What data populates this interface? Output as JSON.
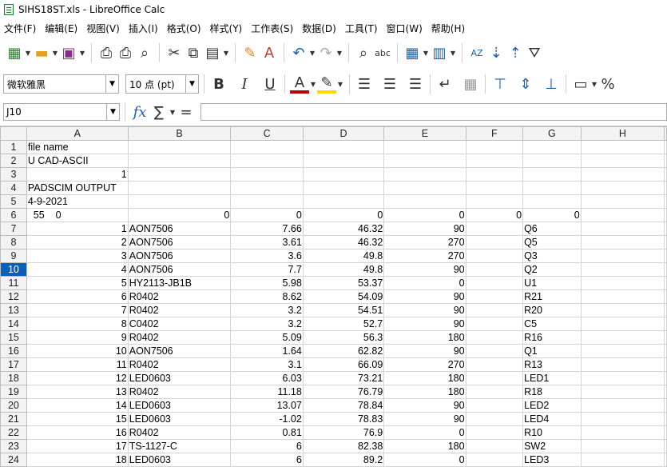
{
  "window": {
    "title": "SIHS18ST.xls - LibreOffice Calc"
  },
  "menu": [
    "文件(F)",
    "编辑(E)",
    "视图(V)",
    "插入(I)",
    "格式(O)",
    "样式(Y)",
    "工作表(S)",
    "数据(D)",
    "工具(T)",
    "窗口(W)",
    "帮助(H)"
  ],
  "format": {
    "font_name": "微软雅黑",
    "font_size": "10 点 (pt)"
  },
  "formula": {
    "cell_ref": "J10",
    "content": ""
  },
  "sheet": {
    "selected_row": 10,
    "columns": [
      "A",
      "B",
      "C",
      "D",
      "E",
      "F",
      "G",
      "H"
    ],
    "rows": [
      {
        "n": 1,
        "cells": [
          "file name",
          "",
          "",
          "",
          "",
          "",
          "",
          ""
        ]
      },
      {
        "n": 2,
        "cells": [
          "U CAD-ASCII",
          "",
          "",
          "",
          "",
          "",
          "",
          ""
        ]
      },
      {
        "n": 3,
        "cells": [
          "1",
          "",
          "",
          "",
          "",
          "",
          "",
          ""
        ]
      },
      {
        "n": 4,
        "cells": [
          "PADSCIM OUTPUT",
          "",
          "",
          "",
          "",
          "",
          "",
          ""
        ]
      },
      {
        "n": 5,
        "cells": [
          "4-9-2021",
          "",
          "",
          "",
          "",
          "",
          "",
          ""
        ]
      },
      {
        "n": 6,
        "cells": [
          "  55    0",
          "0",
          "0",
          "0",
          "0",
          "0",
          "0",
          ""
        ]
      },
      {
        "n": 7,
        "cells": [
          "1",
          "AON7506",
          "7.66",
          "46.32",
          "90",
          "",
          "Q6",
          ""
        ]
      },
      {
        "n": 8,
        "cells": [
          "2",
          "AON7506",
          "3.61",
          "46.32",
          "270",
          "",
          "Q5",
          ""
        ]
      },
      {
        "n": 9,
        "cells": [
          "3",
          "AON7506",
          "3.6",
          "49.8",
          "270",
          "",
          "Q3",
          ""
        ]
      },
      {
        "n": 10,
        "cells": [
          "4",
          "AON7506",
          "7.7",
          "49.8",
          "90",
          "",
          "Q2",
          ""
        ]
      },
      {
        "n": 11,
        "cells": [
          "5",
          "HY2113-JB1B",
          "5.98",
          "53.37",
          "0",
          "",
          "U1",
          ""
        ]
      },
      {
        "n": 12,
        "cells": [
          "6",
          "R0402",
          "8.62",
          "54.09",
          "90",
          "",
          "R21",
          ""
        ]
      },
      {
        "n": 13,
        "cells": [
          "7",
          "R0402",
          "3.2",
          "54.51",
          "90",
          "",
          "R20",
          ""
        ]
      },
      {
        "n": 14,
        "cells": [
          "8",
          "C0402",
          "3.2",
          "52.7",
          "90",
          "",
          "C5",
          ""
        ]
      },
      {
        "n": 15,
        "cells": [
          "9",
          "R0402",
          "5.09",
          "56.3",
          "180",
          "",
          "R16",
          ""
        ]
      },
      {
        "n": 16,
        "cells": [
          "10",
          "AON7506",
          "1.64",
          "62.82",
          "90",
          "",
          "Q1",
          ""
        ]
      },
      {
        "n": 17,
        "cells": [
          "11",
          "R0402",
          "3.1",
          "66.09",
          "270",
          "",
          "R13",
          ""
        ]
      },
      {
        "n": 18,
        "cells": [
          "12",
          "LED0603",
          "6.03",
          "73.21",
          "180",
          "",
          "LED1",
          ""
        ]
      },
      {
        "n": 19,
        "cells": [
          "13",
          "R0402",
          "11.18",
          "76.79",
          "180",
          "",
          "R18",
          ""
        ]
      },
      {
        "n": 20,
        "cells": [
          "14",
          "LED0603",
          "13.07",
          "78.84",
          "90",
          "",
          "LED2",
          ""
        ]
      },
      {
        "n": 21,
        "cells": [
          "15",
          "LED0603",
          "-1.02",
          "78.83",
          "90",
          "",
          "LED4",
          ""
        ]
      },
      {
        "n": 22,
        "cells": [
          "16",
          "R0402",
          "0.81",
          "76.9",
          "0",
          "",
          "R10",
          ""
        ]
      },
      {
        "n": 23,
        "cells": [
          "17",
          "TS-1127-C",
          "6",
          "82.38",
          "180",
          "",
          "SW2",
          ""
        ]
      },
      {
        "n": 24,
        "cells": [
          "18",
          "LED0603",
          "6",
          "89.2",
          "0",
          "",
          "LED3",
          ""
        ]
      }
    ]
  }
}
